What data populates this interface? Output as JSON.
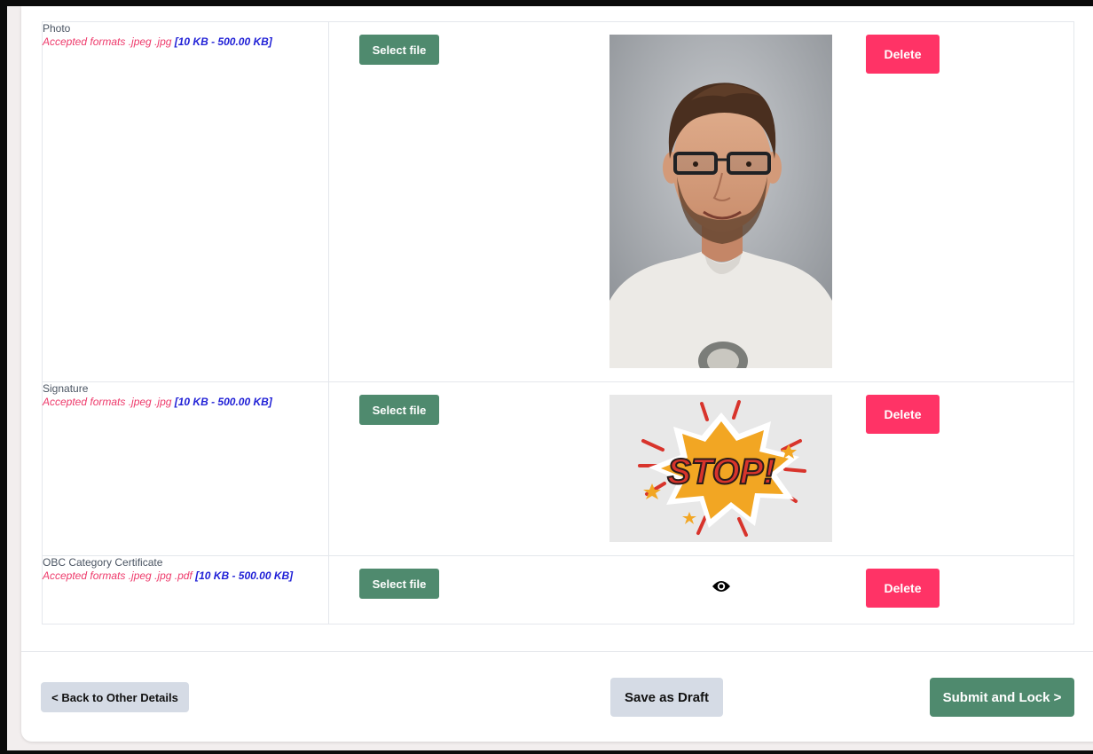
{
  "documents": [
    {
      "label": "Photo",
      "formats": "Accepted formats .jpeg .jpg ",
      "size_range": "[10 KB - 500.00 KB]",
      "select_label": "Select file",
      "delete_label": "Delete",
      "preview": "photo-portrait"
    },
    {
      "label": "Signature",
      "formats": "Accepted formats .jpeg .jpg ",
      "size_range": "[10 KB - 500.00 KB]",
      "select_label": "Select file",
      "delete_label": "Delete",
      "preview": "stop-sticker-image"
    },
    {
      "label": "OBC Category Certificate",
      "formats": "Accepted formats .jpeg .jpg .pdf ",
      "size_range": "[10 KB - 500.00 KB]",
      "select_label": "Select file",
      "delete_label": "Delete",
      "preview": "eye-icon"
    }
  ],
  "sticker": {
    "text": "STOP!"
  },
  "footer": {
    "back_label": "< Back to Other Details",
    "draft_label": "Save as Draft",
    "submit_label": "Submit and Lock >"
  },
  "colors": {
    "primary_green": "#4f8a6e",
    "delete_red": "#ff3366",
    "format_pink": "#ee3a6b",
    "size_blue": "#1f1fd6",
    "neutral_button": "#d5dbe5"
  }
}
